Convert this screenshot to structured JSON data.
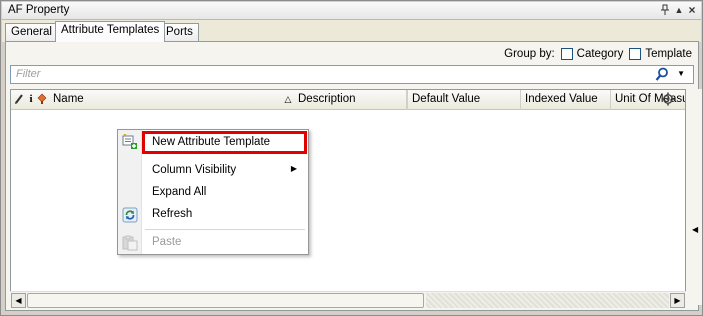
{
  "window": {
    "title": "AF Property",
    "buttons": {
      "pin": "↓",
      "up": "▲",
      "close": "×"
    }
  },
  "tabs": [
    {
      "label": "General",
      "active": false
    },
    {
      "label": "Attribute Templates",
      "active": true
    },
    {
      "label": "Ports",
      "active": false
    }
  ],
  "toolbar": {
    "group_by_label": "Group by:",
    "category_label": "Category",
    "template_label": "Template",
    "category_checked": false,
    "template_checked": false
  },
  "filter": {
    "placeholder": "Filter",
    "value": ""
  },
  "grid": {
    "columns": [
      {
        "label": "Name"
      },
      {
        "label": "Description",
        "sort": "ascending"
      },
      {
        "label": "Default Value"
      },
      {
        "label": "Indexed Value"
      },
      {
        "label": "Unit Of Measure"
      }
    ],
    "rows": []
  },
  "context_menu": {
    "items": [
      {
        "label": "New Attribute Template",
        "icon": "new-attribute-template-icon",
        "highlighted": true,
        "enabled": true
      },
      {
        "label": "Column Visibility",
        "submenu": true,
        "enabled": true
      },
      {
        "label": "Expand All",
        "enabled": true
      },
      {
        "label": "Refresh",
        "icon": "refresh-icon",
        "enabled": true
      },
      {
        "label": "Paste",
        "icon": "paste-icon",
        "enabled": false
      }
    ]
  },
  "colors": {
    "highlight_border": "#e00000",
    "panel_bg": "#f5f4ee",
    "window_bg": "#d4d0c8"
  }
}
